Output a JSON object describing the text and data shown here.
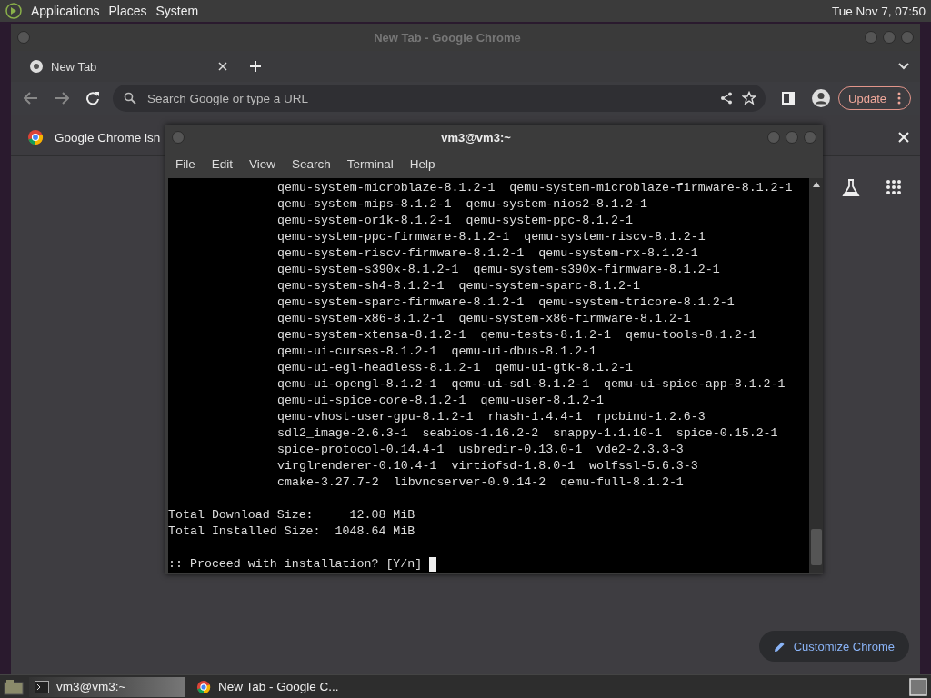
{
  "top_panel": {
    "menus": [
      "Applications",
      "Places",
      "System"
    ],
    "clock": "Tue Nov 7, 07:50"
  },
  "chrome_window": {
    "title": "New Tab - Google Chrome",
    "tabs": [
      {
        "label": "New Tab",
        "selected": true
      }
    ],
    "address_bar": {
      "placeholder": "Search Google or type a URL"
    },
    "update_button": "Update",
    "infobar": {
      "text": "Google Chrome isn"
    },
    "customize_button": "Customize Chrome"
  },
  "terminal_window": {
    "title": "vm3@vm3:~",
    "menu": [
      "File",
      "Edit",
      "View",
      "Search",
      "Terminal",
      "Help"
    ],
    "package_lines": [
      "qemu-system-microblaze-8.1.2-1  qemu-system-microblaze-firmware-8.1.2-1",
      "qemu-system-mips-8.1.2-1  qemu-system-nios2-8.1.2-1",
      "qemu-system-or1k-8.1.2-1  qemu-system-ppc-8.1.2-1",
      "qemu-system-ppc-firmware-8.1.2-1  qemu-system-riscv-8.1.2-1",
      "qemu-system-riscv-firmware-8.1.2-1  qemu-system-rx-8.1.2-1",
      "qemu-system-s390x-8.1.2-1  qemu-system-s390x-firmware-8.1.2-1",
      "qemu-system-sh4-8.1.2-1  qemu-system-sparc-8.1.2-1",
      "qemu-system-sparc-firmware-8.1.2-1  qemu-system-tricore-8.1.2-1",
      "qemu-system-x86-8.1.2-1  qemu-system-x86-firmware-8.1.2-1",
      "qemu-system-xtensa-8.1.2-1  qemu-tests-8.1.2-1  qemu-tools-8.1.2-1",
      "qemu-ui-curses-8.1.2-1  qemu-ui-dbus-8.1.2-1",
      "qemu-ui-egl-headless-8.1.2-1  qemu-ui-gtk-8.1.2-1",
      "qemu-ui-opengl-8.1.2-1  qemu-ui-sdl-8.1.2-1  qemu-ui-spice-app-8.1.2-1",
      "qemu-ui-spice-core-8.1.2-1  qemu-user-8.1.2-1",
      "qemu-vhost-user-gpu-8.1.2-1  rhash-1.4.4-1  rpcbind-1.2.6-3",
      "sdl2_image-2.6.3-1  seabios-1.16.2-2  snappy-1.1.10-1  spice-0.15.2-1",
      "spice-protocol-0.14.4-1  usbredir-0.13.0-1  vde2-2.3.3-3",
      "virglrenderer-0.10.4-1  virtiofsd-1.8.0-1  wolfssl-5.6.3-3",
      "cmake-3.27.7-2  libvncserver-0.9.14-2  qemu-full-8.1.2-1"
    ],
    "totals": [
      "Total Download Size:     12.08 MiB",
      "Total Installed Size:  1048.64 MiB"
    ],
    "prompt": ":: Proceed with installation? [Y/n]"
  },
  "taskbar": {
    "items": [
      {
        "kind": "terminal",
        "label": "vm3@vm3:~",
        "selected": true
      },
      {
        "kind": "browser",
        "label": "New Tab - Google C...",
        "selected": false
      }
    ]
  }
}
